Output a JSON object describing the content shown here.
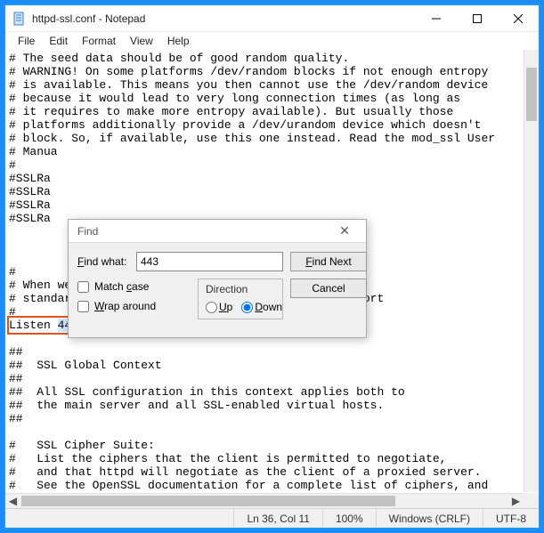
{
  "window": {
    "title": "httpd-ssl.conf - Notepad"
  },
  "menu": {
    "file": "File",
    "edit": "Edit",
    "format": "Format",
    "view": "View",
    "help": "Help"
  },
  "editor": {
    "lines": [
      "# The seed data should be of good random quality.",
      "# WARNING! On some platforms /dev/random blocks if not enough entropy",
      "# is available. This means you then cannot use the /dev/random device",
      "# because it would lead to very long connection times (as long as",
      "# it requires to make more entropy available). But usually those",
      "# platforms additionally provide a /dev/urandom device which doesn't",
      "# block. So, if available, use this one instead. Read the mod_ssl User",
      "# Manua",
      "#",
      "#SSLRa",
      "#SSLRa",
      "#SSLRa",
      "#SSLRa",
      "",
      "",
      "",
      "#",
      "# When we also provide SSL we have to listen to the",
      "# standard HTTP port (see above) and to the HTTPS port",
      "#"
    ],
    "listen_prefix": "Listen ",
    "listen_value": "443",
    "lines_after": [
      "",
      "##",
      "##  SSL Global Context",
      "##",
      "##  All SSL configuration in this context applies both to",
      "##  the main server and all SSL-enabled virtual hosts.",
      "##",
      "",
      "#   SSL Cipher Suite:",
      "#   List the ciphers that the client is permitted to negotiate,",
      "#   and that httpd will negotiate as the client of a proxied server.",
      "#   See the OpenSSL documentation for a complete list of ciphers, and"
    ]
  },
  "find": {
    "title": "Find",
    "label": "Find what:",
    "value": "443",
    "find_next": "Find Next",
    "cancel": "Cancel",
    "direction_label": "Direction",
    "up": "Up",
    "down": "Down",
    "direction_selected": "down",
    "match_case": "Match case",
    "match_case_checked": false,
    "wrap_around": "Wrap around",
    "wrap_around_checked": false
  },
  "status": {
    "position": "Ln 36, Col 11",
    "zoom": "100%",
    "eol": "Windows (CRLF)",
    "encoding": "UTF-8"
  }
}
